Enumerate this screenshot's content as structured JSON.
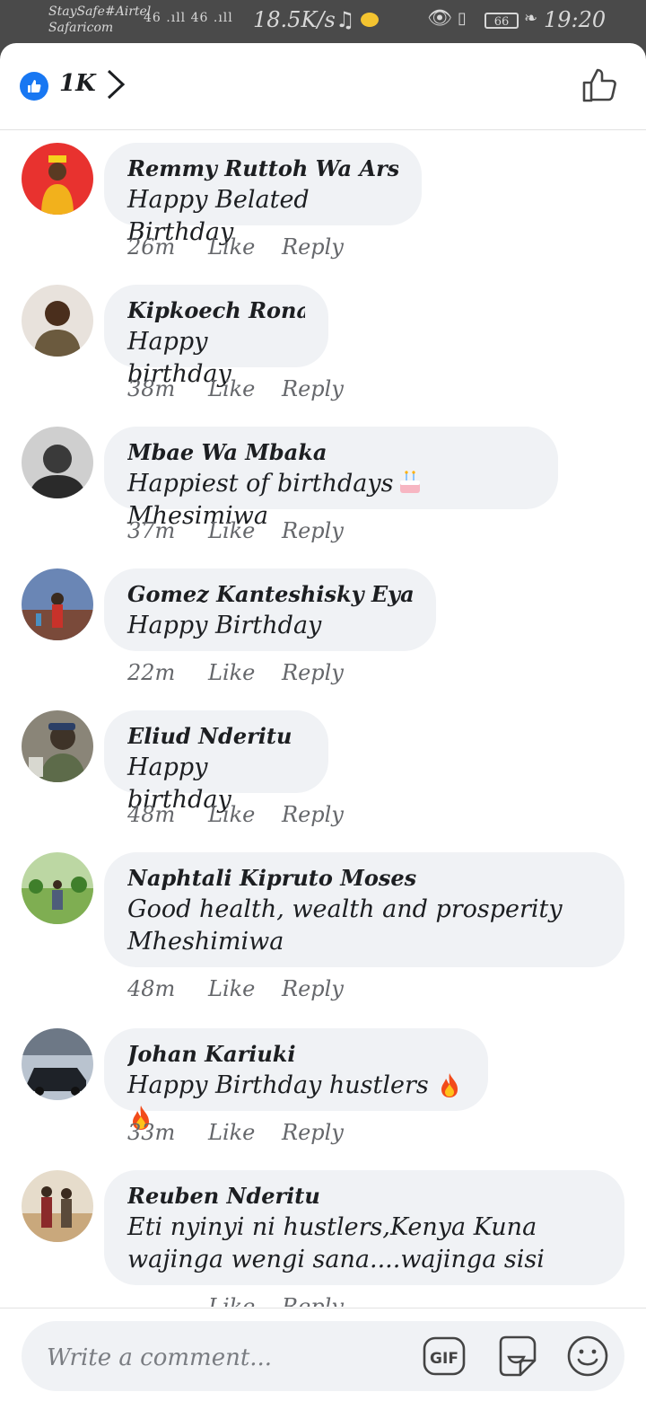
{
  "status_bar": {
    "carrier_line1": "StaySafe#Airtel",
    "carrier_line2": "Safaricom",
    "signal": "46 .ıll 46 .ıll",
    "speed": "18.5K/s",
    "battery": "66",
    "time": "19:20"
  },
  "header": {
    "reaction_count": "1K"
  },
  "comments": [
    {
      "name": "Remmy Ruttoh Wa Arsenali",
      "text": "Happy Belated Birthday",
      "time": "26m",
      "like": "Like",
      "reply": "Reply",
      "avatar_color": "#e8322f"
    },
    {
      "name": "Kipkoech Ronald",
      "text": "Happy birthday",
      "time": "38m",
      "like": "Like",
      "reply": "Reply",
      "avatar_color": "#b9a897"
    },
    {
      "name": "Mbae Wa Mbaka",
      "text_before": "Happiest of birthdays",
      "text_after": "Mhesimiwa",
      "time": "37m",
      "like": "Like",
      "reply": "Reply",
      "avatar_color": "#9a9a9a"
    },
    {
      "name": "Gomez Kanteshisky Eyanae Jr.",
      "text": "Happy Birthday",
      "time": "22m",
      "like": "Like",
      "reply": "Reply",
      "avatar_color": "#5a6b8c"
    },
    {
      "name": "Eliud Nderitu",
      "text": "Happy birthday",
      "time": "48m",
      "like": "Like",
      "reply": "Reply",
      "avatar_color": "#6f6a5e"
    },
    {
      "name": "Naphtali Kipruto Moses",
      "text": "Good health, wealth and prosperity Mheshimiwa",
      "time": "48m",
      "like": "Like",
      "reply": "Reply",
      "avatar_color": "#6fa34b"
    },
    {
      "name": "Johan Kariuki",
      "text": "Happy Birthday hustlers",
      "time": "33m",
      "like": "Like",
      "reply": "Reply",
      "avatar_color": "#3b4048"
    },
    {
      "name": "Reuben Nderitu",
      "text": "Eti nyinyi ni hustlers,Kenya Kuna wajinga wengi sana....wajinga sisi",
      "time": "",
      "like": "Like",
      "reply": "Reply",
      "avatar_color": "#c9b28e"
    }
  ],
  "composer": {
    "placeholder": "Write a comment...",
    "gif_label": "GIF"
  }
}
